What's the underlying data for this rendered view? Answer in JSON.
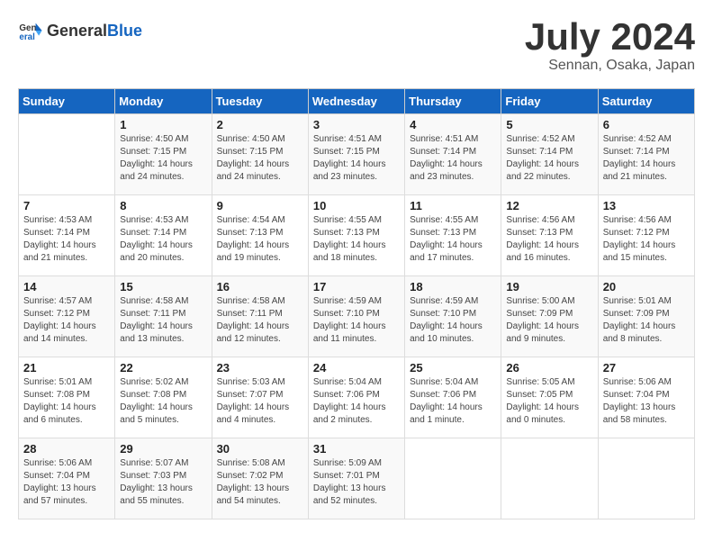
{
  "header": {
    "logo_general": "General",
    "logo_blue": "Blue",
    "month_title": "July 2024",
    "location": "Sennan, Osaka, Japan"
  },
  "calendar": {
    "days_of_week": [
      "Sunday",
      "Monday",
      "Tuesday",
      "Wednesday",
      "Thursday",
      "Friday",
      "Saturday"
    ],
    "weeks": [
      [
        {
          "day": "",
          "info": ""
        },
        {
          "day": "1",
          "info": "Sunrise: 4:50 AM\nSunset: 7:15 PM\nDaylight: 14 hours\nand 24 minutes."
        },
        {
          "day": "2",
          "info": "Sunrise: 4:50 AM\nSunset: 7:15 PM\nDaylight: 14 hours\nand 24 minutes."
        },
        {
          "day": "3",
          "info": "Sunrise: 4:51 AM\nSunset: 7:15 PM\nDaylight: 14 hours\nand 23 minutes."
        },
        {
          "day": "4",
          "info": "Sunrise: 4:51 AM\nSunset: 7:14 PM\nDaylight: 14 hours\nand 23 minutes."
        },
        {
          "day": "5",
          "info": "Sunrise: 4:52 AM\nSunset: 7:14 PM\nDaylight: 14 hours\nand 22 minutes."
        },
        {
          "day": "6",
          "info": "Sunrise: 4:52 AM\nSunset: 7:14 PM\nDaylight: 14 hours\nand 21 minutes."
        }
      ],
      [
        {
          "day": "7",
          "info": "Sunrise: 4:53 AM\nSunset: 7:14 PM\nDaylight: 14 hours\nand 21 minutes."
        },
        {
          "day": "8",
          "info": "Sunrise: 4:53 AM\nSunset: 7:14 PM\nDaylight: 14 hours\nand 20 minutes."
        },
        {
          "day": "9",
          "info": "Sunrise: 4:54 AM\nSunset: 7:13 PM\nDaylight: 14 hours\nand 19 minutes."
        },
        {
          "day": "10",
          "info": "Sunrise: 4:55 AM\nSunset: 7:13 PM\nDaylight: 14 hours\nand 18 minutes."
        },
        {
          "day": "11",
          "info": "Sunrise: 4:55 AM\nSunset: 7:13 PM\nDaylight: 14 hours\nand 17 minutes."
        },
        {
          "day": "12",
          "info": "Sunrise: 4:56 AM\nSunset: 7:13 PM\nDaylight: 14 hours\nand 16 minutes."
        },
        {
          "day": "13",
          "info": "Sunrise: 4:56 AM\nSunset: 7:12 PM\nDaylight: 14 hours\nand 15 minutes."
        }
      ],
      [
        {
          "day": "14",
          "info": "Sunrise: 4:57 AM\nSunset: 7:12 PM\nDaylight: 14 hours\nand 14 minutes."
        },
        {
          "day": "15",
          "info": "Sunrise: 4:58 AM\nSunset: 7:11 PM\nDaylight: 14 hours\nand 13 minutes."
        },
        {
          "day": "16",
          "info": "Sunrise: 4:58 AM\nSunset: 7:11 PM\nDaylight: 14 hours\nand 12 minutes."
        },
        {
          "day": "17",
          "info": "Sunrise: 4:59 AM\nSunset: 7:10 PM\nDaylight: 14 hours\nand 11 minutes."
        },
        {
          "day": "18",
          "info": "Sunrise: 4:59 AM\nSunset: 7:10 PM\nDaylight: 14 hours\nand 10 minutes."
        },
        {
          "day": "19",
          "info": "Sunrise: 5:00 AM\nSunset: 7:09 PM\nDaylight: 14 hours\nand 9 minutes."
        },
        {
          "day": "20",
          "info": "Sunrise: 5:01 AM\nSunset: 7:09 PM\nDaylight: 14 hours\nand 8 minutes."
        }
      ],
      [
        {
          "day": "21",
          "info": "Sunrise: 5:01 AM\nSunset: 7:08 PM\nDaylight: 14 hours\nand 6 minutes."
        },
        {
          "day": "22",
          "info": "Sunrise: 5:02 AM\nSunset: 7:08 PM\nDaylight: 14 hours\nand 5 minutes."
        },
        {
          "day": "23",
          "info": "Sunrise: 5:03 AM\nSunset: 7:07 PM\nDaylight: 14 hours\nand 4 minutes."
        },
        {
          "day": "24",
          "info": "Sunrise: 5:04 AM\nSunset: 7:06 PM\nDaylight: 14 hours\nand 2 minutes."
        },
        {
          "day": "25",
          "info": "Sunrise: 5:04 AM\nSunset: 7:06 PM\nDaylight: 14 hours\nand 1 minute."
        },
        {
          "day": "26",
          "info": "Sunrise: 5:05 AM\nSunset: 7:05 PM\nDaylight: 14 hours\nand 0 minutes."
        },
        {
          "day": "27",
          "info": "Sunrise: 5:06 AM\nSunset: 7:04 PM\nDaylight: 13 hours\nand 58 minutes."
        }
      ],
      [
        {
          "day": "28",
          "info": "Sunrise: 5:06 AM\nSunset: 7:04 PM\nDaylight: 13 hours\nand 57 minutes."
        },
        {
          "day": "29",
          "info": "Sunrise: 5:07 AM\nSunset: 7:03 PM\nDaylight: 13 hours\nand 55 minutes."
        },
        {
          "day": "30",
          "info": "Sunrise: 5:08 AM\nSunset: 7:02 PM\nDaylight: 13 hours\nand 54 minutes."
        },
        {
          "day": "31",
          "info": "Sunrise: 5:09 AM\nSunset: 7:01 PM\nDaylight: 13 hours\nand 52 minutes."
        },
        {
          "day": "",
          "info": ""
        },
        {
          "day": "",
          "info": ""
        },
        {
          "day": "",
          "info": ""
        }
      ]
    ]
  }
}
